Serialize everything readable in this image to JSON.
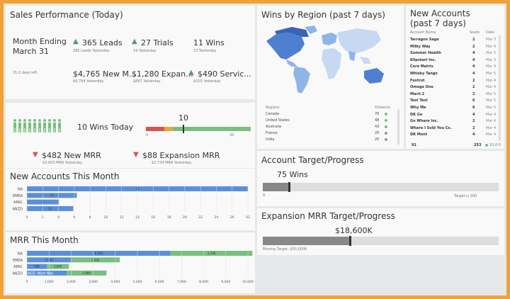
{
  "sales": {
    "title": "Sales Performance (Today)",
    "month_label_line1": "Month Ending",
    "month_label_line2": "March 31",
    "days_left": "31.0 days left",
    "leads_value": "365 Leads",
    "leads_sub": "285 Leads Yesterday",
    "trials_value": "27 Trials",
    "trials_sub": "19 Yesterday",
    "wins_value": "11 Wins",
    "wins_sub": "15 Yesterday",
    "new_mrr_value": "$4,765 New M...",
    "new_mrr_sub": "$6,794 Yesterday",
    "expansion_value": "$1,280 Expan...",
    "expansion_sub": "$897 Yesterday",
    "services_value": "$490 Servic...",
    "services_sub": "$310 Yesterday"
  },
  "wins_today": {
    "label": "10 Wins Today",
    "gauge_value": "10",
    "gauge_min": "0",
    "gauge_max": "20",
    "new_mrr": "$482 New MRR",
    "new_mrr_sub": "$3,003 MRR Yesterday",
    "expansion_mrr": "$88 Expansion MRR",
    "expansion_mrr_sub": "$2,734 MRR Yesterday"
  },
  "wins_region": {
    "title": "Wins by Region (past 7 days)",
    "col_region": "Regions",
    "col_value": "Distance",
    "rows": [
      {
        "name": "Canada",
        "value": "76"
      },
      {
        "name": "United States",
        "value": "48"
      },
      {
        "name": "Australia",
        "value": "43"
      },
      {
        "name": "France",
        "value": "20"
      },
      {
        "name": "India",
        "value": "20"
      }
    ]
  },
  "new_accounts": {
    "title_line1": "New Accounts",
    "title_line2": "(past 7 days)",
    "col_name": "Account Name",
    "col_seats": "Seats",
    "col_date": "Date",
    "rows": [
      {
        "name": "Tarragon Sage",
        "seats": "2",
        "date": "Mar 3"
      },
      {
        "name": "Milky Way",
        "seats": "2",
        "date": "Mar 4"
      },
      {
        "name": "Summer Health",
        "seats": "4",
        "date": "Mar 5"
      },
      {
        "name": "Klipstart Inc.",
        "seats": "4",
        "date": "Mar 3"
      },
      {
        "name": "Core Matrix",
        "seats": "4",
        "date": "Mar 4"
      },
      {
        "name": "Whisky Tango",
        "seats": "4",
        "date": "Mar 5"
      },
      {
        "name": "Foxtrot",
        "seats": "2",
        "date": "Mar 4"
      },
      {
        "name": "Omega One",
        "seats": "2",
        "date": "Mar 4"
      },
      {
        "name": "Mach 2",
        "seats": "2",
        "date": "Mar 5"
      },
      {
        "name": "Test Test",
        "seats": "6",
        "date": "Mar 5"
      },
      {
        "name": "Why Me",
        "seats": "6",
        "date": "Mar 5"
      },
      {
        "name": "DK Go",
        "seats": "4",
        "date": "Mar 4"
      },
      {
        "name": "Go Where Inc.",
        "seats": "2",
        "date": "Mar 4"
      },
      {
        "name": "Where I Sold You Co.",
        "seats": "2",
        "date": "Mar 4"
      },
      {
        "name": "DK Mont",
        "seats": "4",
        "date": "Mar 4"
      }
    ],
    "footer_count": "91",
    "footer_seats": "253",
    "footer_date": "10,0-5"
  },
  "account_target": {
    "title": "Account Target/Progress",
    "value_label": "75 Wins",
    "min": "0",
    "target_label": "Target is 300",
    "progress": 0.11
  },
  "expansion_target": {
    "title": "Expansion MRR Target/Progress",
    "value_label": "$18,600K",
    "target_label": "Moving Target: $50,000K",
    "progress": 0.37
  },
  "colors": {
    "accent_blue": "#5b8fd9",
    "accent_green": "#79bf7f",
    "gauge_red": "#d9534f",
    "gauge_orange": "#f0a23a"
  },
  "chart_data": [
    {
      "type": "bar",
      "title": "New Accounts This Month",
      "categories": [
        "NA",
        "EMEA",
        "APAC",
        "ANZO"
      ],
      "values": [
        62,
        14,
        9,
        13
      ],
      "xlim": [
        0,
        62
      ],
      "xticks": [
        "0",
        "2",
        "4",
        "6",
        "8",
        "10",
        "12",
        "14",
        "16",
        "18",
        "20",
        "22",
        "24",
        "26",
        "62"
      ]
    },
    {
      "type": "bar",
      "title": "MRR This Month",
      "categories": [
        "NA",
        "EMEA",
        "APAC",
        "ANZO"
      ],
      "series": [
        {
          "values": [
            6500,
            2000,
            900,
            1800
          ],
          "labels": [
            "6,500",
            "2,000",
            "900",
            ""
          ]
        },
        {
          "values": [
            3700,
            2200,
            1000,
            1800
          ],
          "labels": [
            "3,700",
            "2,200",
            "1,000",
            "1,800"
          ]
        }
      ],
      "annotation": "ADZ: Mart Mal",
      "xlim": [
        0,
        10000
      ],
      "xticks": [
        "0",
        "1,000",
        "2,000",
        "3,000",
        "4,000",
        "5,000",
        "6,000",
        "7,000",
        "8,000",
        "9,000",
        "10,000"
      ]
    }
  ]
}
